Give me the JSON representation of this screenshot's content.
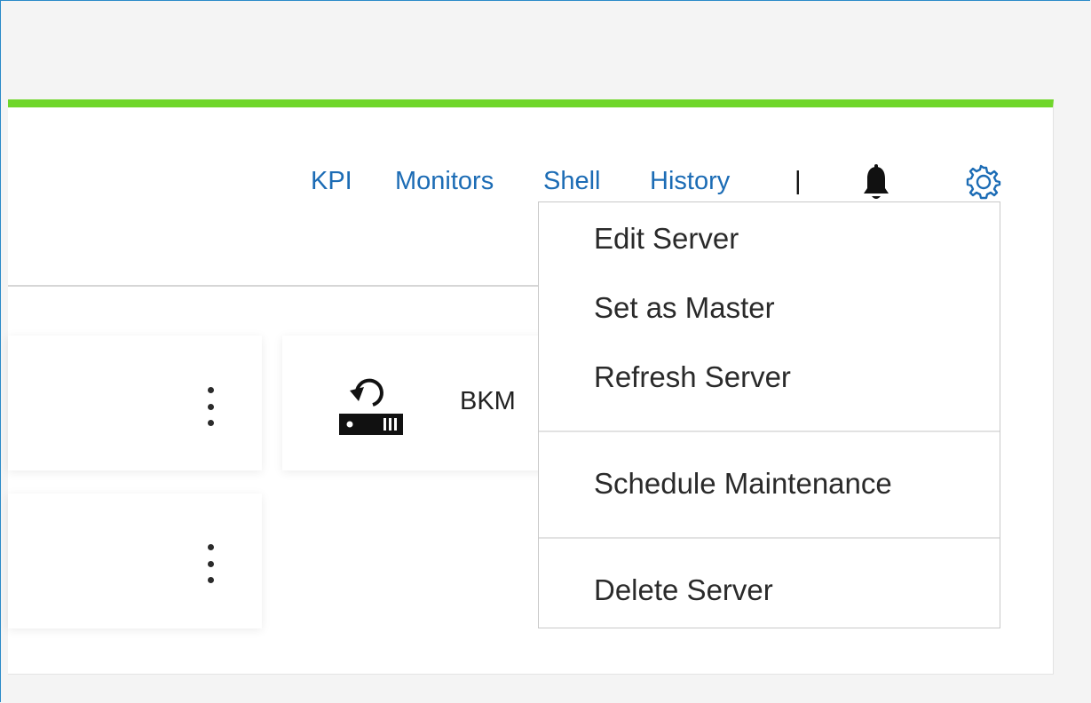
{
  "nav": {
    "kpi": "KPI",
    "monitors": "Monitors",
    "shell": "Shell",
    "history": "History",
    "separator": "|",
    "bell_icon": "bell-icon",
    "gear_icon": "gear-icon"
  },
  "server_tile": {
    "label": "BKM",
    "icon": "server-refresh-icon"
  },
  "menu": {
    "items": [
      "Edit Server",
      "Set as Master",
      "Refresh Server",
      "Schedule Maintenance",
      "Delete Server"
    ]
  },
  "colors": {
    "accent_bar": "#6fd62a",
    "link": "#1c6cb5"
  }
}
